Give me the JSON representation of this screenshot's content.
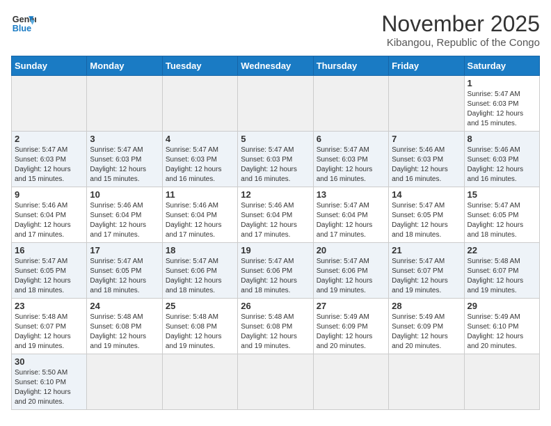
{
  "logo": {
    "line1": "General",
    "line2": "Blue"
  },
  "title": "November 2025",
  "subtitle": "Kibangou, Republic of the Congo",
  "weekdays": [
    "Sunday",
    "Monday",
    "Tuesday",
    "Wednesday",
    "Thursday",
    "Friday",
    "Saturday"
  ],
  "weeks": [
    [
      {
        "day": "",
        "info": ""
      },
      {
        "day": "",
        "info": ""
      },
      {
        "day": "",
        "info": ""
      },
      {
        "day": "",
        "info": ""
      },
      {
        "day": "",
        "info": ""
      },
      {
        "day": "",
        "info": ""
      },
      {
        "day": "1",
        "info": "Sunrise: 5:47 AM\nSunset: 6:03 PM\nDaylight: 12 hours and 15 minutes."
      }
    ],
    [
      {
        "day": "2",
        "info": "Sunrise: 5:47 AM\nSunset: 6:03 PM\nDaylight: 12 hours and 15 minutes."
      },
      {
        "day": "3",
        "info": "Sunrise: 5:47 AM\nSunset: 6:03 PM\nDaylight: 12 hours and 15 minutes."
      },
      {
        "day": "4",
        "info": "Sunrise: 5:47 AM\nSunset: 6:03 PM\nDaylight: 12 hours and 16 minutes."
      },
      {
        "day": "5",
        "info": "Sunrise: 5:47 AM\nSunset: 6:03 PM\nDaylight: 12 hours and 16 minutes."
      },
      {
        "day": "6",
        "info": "Sunrise: 5:47 AM\nSunset: 6:03 PM\nDaylight: 12 hours and 16 minutes."
      },
      {
        "day": "7",
        "info": "Sunrise: 5:46 AM\nSunset: 6:03 PM\nDaylight: 12 hours and 16 minutes."
      },
      {
        "day": "8",
        "info": "Sunrise: 5:46 AM\nSunset: 6:03 PM\nDaylight: 12 hours and 16 minutes."
      }
    ],
    [
      {
        "day": "9",
        "info": "Sunrise: 5:46 AM\nSunset: 6:04 PM\nDaylight: 12 hours and 17 minutes."
      },
      {
        "day": "10",
        "info": "Sunrise: 5:46 AM\nSunset: 6:04 PM\nDaylight: 12 hours and 17 minutes."
      },
      {
        "day": "11",
        "info": "Sunrise: 5:46 AM\nSunset: 6:04 PM\nDaylight: 12 hours and 17 minutes."
      },
      {
        "day": "12",
        "info": "Sunrise: 5:46 AM\nSunset: 6:04 PM\nDaylight: 12 hours and 17 minutes."
      },
      {
        "day": "13",
        "info": "Sunrise: 5:47 AM\nSunset: 6:04 PM\nDaylight: 12 hours and 17 minutes."
      },
      {
        "day": "14",
        "info": "Sunrise: 5:47 AM\nSunset: 6:05 PM\nDaylight: 12 hours and 18 minutes."
      },
      {
        "day": "15",
        "info": "Sunrise: 5:47 AM\nSunset: 6:05 PM\nDaylight: 12 hours and 18 minutes."
      }
    ],
    [
      {
        "day": "16",
        "info": "Sunrise: 5:47 AM\nSunset: 6:05 PM\nDaylight: 12 hours and 18 minutes."
      },
      {
        "day": "17",
        "info": "Sunrise: 5:47 AM\nSunset: 6:05 PM\nDaylight: 12 hours and 18 minutes."
      },
      {
        "day": "18",
        "info": "Sunrise: 5:47 AM\nSunset: 6:06 PM\nDaylight: 12 hours and 18 minutes."
      },
      {
        "day": "19",
        "info": "Sunrise: 5:47 AM\nSunset: 6:06 PM\nDaylight: 12 hours and 18 minutes."
      },
      {
        "day": "20",
        "info": "Sunrise: 5:47 AM\nSunset: 6:06 PM\nDaylight: 12 hours and 19 minutes."
      },
      {
        "day": "21",
        "info": "Sunrise: 5:47 AM\nSunset: 6:07 PM\nDaylight: 12 hours and 19 minutes."
      },
      {
        "day": "22",
        "info": "Sunrise: 5:48 AM\nSunset: 6:07 PM\nDaylight: 12 hours and 19 minutes."
      }
    ],
    [
      {
        "day": "23",
        "info": "Sunrise: 5:48 AM\nSunset: 6:07 PM\nDaylight: 12 hours and 19 minutes."
      },
      {
        "day": "24",
        "info": "Sunrise: 5:48 AM\nSunset: 6:08 PM\nDaylight: 12 hours and 19 minutes."
      },
      {
        "day": "25",
        "info": "Sunrise: 5:48 AM\nSunset: 6:08 PM\nDaylight: 12 hours and 19 minutes."
      },
      {
        "day": "26",
        "info": "Sunrise: 5:48 AM\nSunset: 6:08 PM\nDaylight: 12 hours and 19 minutes."
      },
      {
        "day": "27",
        "info": "Sunrise: 5:49 AM\nSunset: 6:09 PM\nDaylight: 12 hours and 20 minutes."
      },
      {
        "day": "28",
        "info": "Sunrise: 5:49 AM\nSunset: 6:09 PM\nDaylight: 12 hours and 20 minutes."
      },
      {
        "day": "29",
        "info": "Sunrise: 5:49 AM\nSunset: 6:10 PM\nDaylight: 12 hours and 20 minutes."
      }
    ],
    [
      {
        "day": "30",
        "info": "Sunrise: 5:50 AM\nSunset: 6:10 PM\nDaylight: 12 hours and 20 minutes."
      },
      {
        "day": "",
        "info": ""
      },
      {
        "day": "",
        "info": ""
      },
      {
        "day": "",
        "info": ""
      },
      {
        "day": "",
        "info": ""
      },
      {
        "day": "",
        "info": ""
      },
      {
        "day": "",
        "info": ""
      }
    ]
  ]
}
